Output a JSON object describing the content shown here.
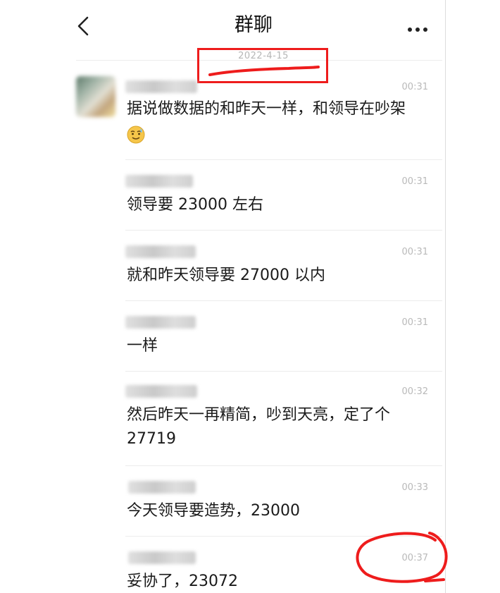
{
  "header": {
    "title": "群聊",
    "back_icon": "chevron-left-icon",
    "more_icon": "more-dots-icon"
  },
  "date_label": "2022-4-15",
  "annotation_color": "#ee1c1c",
  "messages": [
    {
      "time": "00:31",
      "text": "据说做数据的和昨天一样，和领导在吵架",
      "emoji": "sweat-smile-emoji"
    },
    {
      "time": "00:31",
      "text": "领导要 23000 左右"
    },
    {
      "time": "00:31",
      "text": "就和昨天领导要 27000 以内"
    },
    {
      "time": "00:31",
      "text": "一样"
    },
    {
      "time": "00:32",
      "text": "然后昨天一再精简，吵到天亮，定了个\n27719"
    },
    {
      "time": "00:33",
      "text": "今天领导要造势，23000"
    },
    {
      "time": "00:37",
      "text": "妥协了，23072"
    }
  ]
}
